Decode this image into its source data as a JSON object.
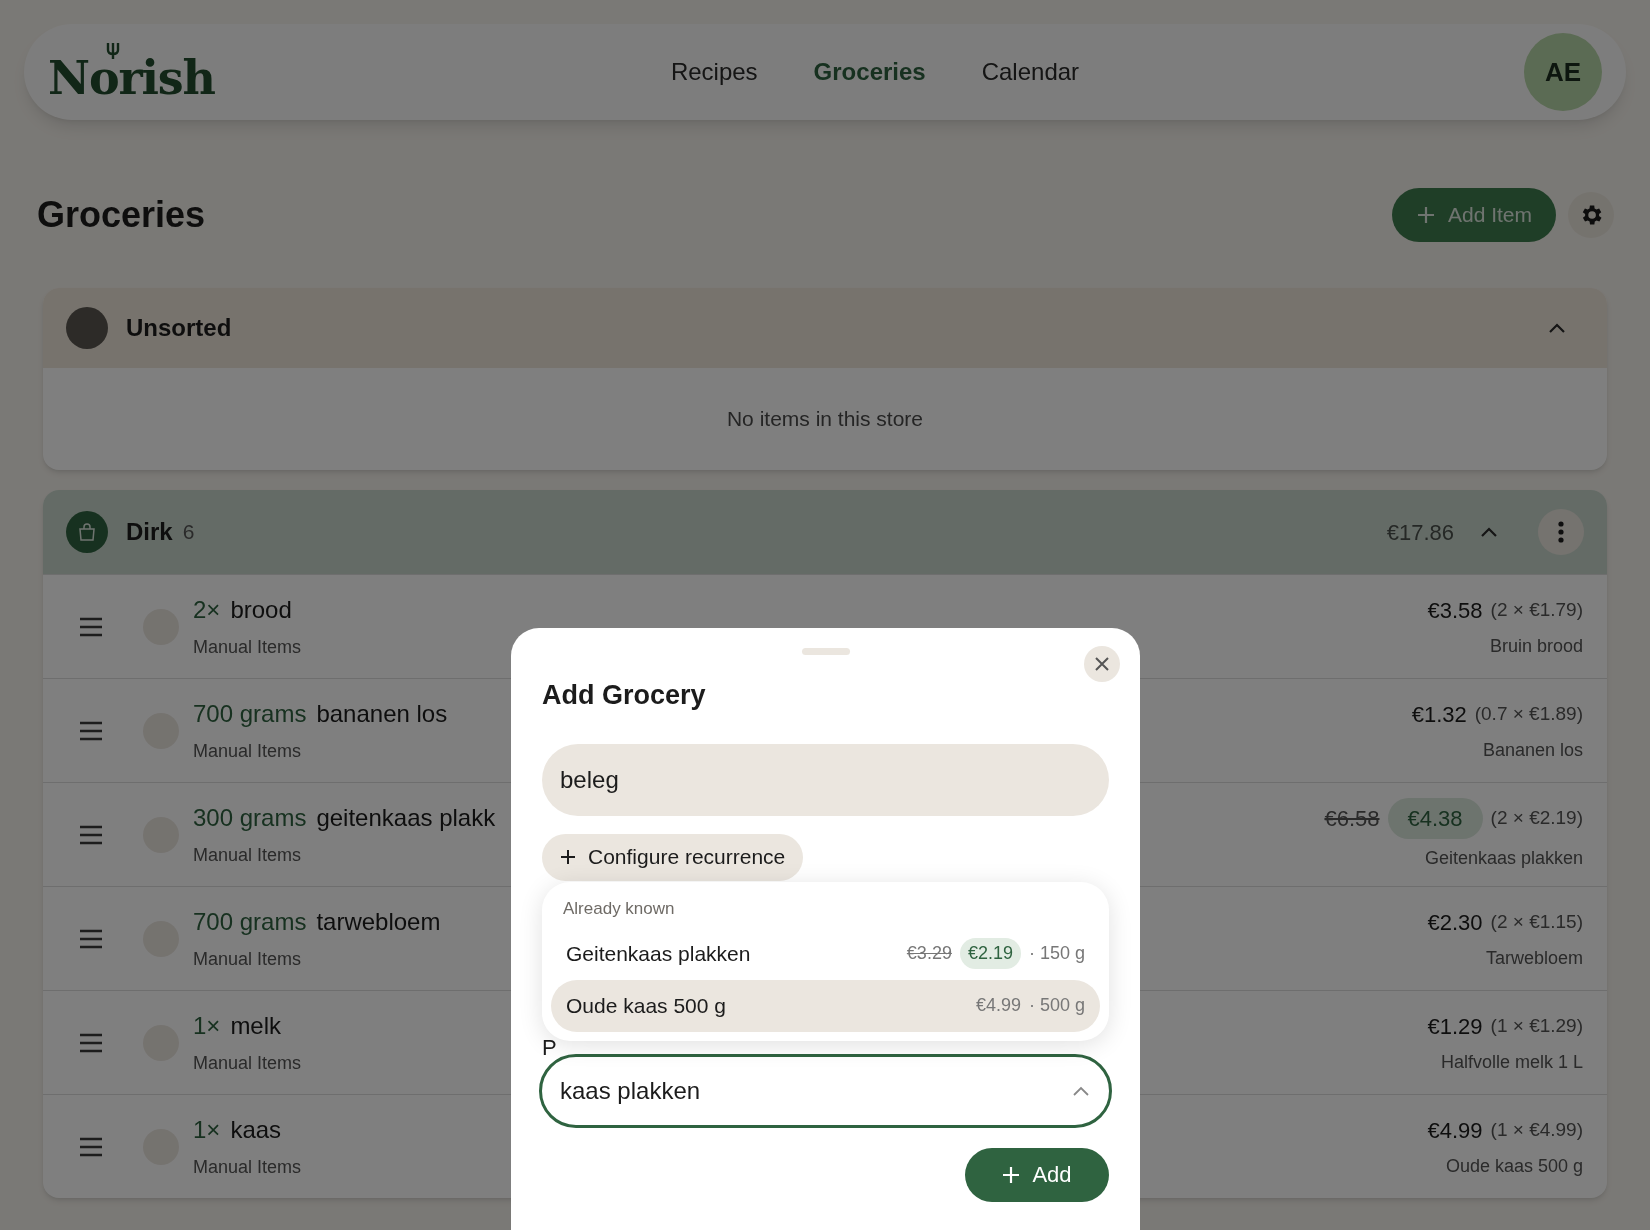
{
  "header": {
    "logo": "Norish",
    "nav": [
      {
        "label": "Recipes",
        "selected": false
      },
      {
        "label": "Groceries",
        "selected": true
      },
      {
        "label": "Calendar",
        "selected": false
      }
    ],
    "avatar": "AE"
  },
  "page": {
    "title": "Groceries",
    "add_button": "Add Item"
  },
  "stores": [
    {
      "kind": "unsorted",
      "name": "Unsorted",
      "expanded": true,
      "empty_text": "No items in this store"
    },
    {
      "kind": "store",
      "name": "Dirk",
      "count": "6",
      "total": "€17.86",
      "expanded": true,
      "items": [
        {
          "amount": "2×",
          "name": "brood",
          "source": "Manual Items",
          "checked": false,
          "price": "€3.58",
          "breakdown": "(2 × €1.79)",
          "product": "Bruin brood"
        },
        {
          "amount": "700 grams",
          "name": "bananen los",
          "source": "Manual Items",
          "checked": false,
          "price": "€1.32",
          "breakdown": "(0.7 × €1.89)",
          "product": "Bananen los"
        },
        {
          "amount": "300 grams",
          "name": "geitenkaas plakk",
          "source": "Manual Items",
          "checked": false,
          "old_price": "€6.58",
          "price": "€4.38",
          "breakdown": "(2 × €2.19)",
          "product": "Geitenkaas plakken"
        },
        {
          "amount": "700 grams",
          "name": "tarwebloem",
          "source": "Manual Items",
          "checked": false,
          "price": "€2.30",
          "breakdown": "(2 × €1.15)",
          "product": "Tarwebloem"
        },
        {
          "amount": "1×",
          "name": "melk",
          "source": "Manual Items",
          "checked": false,
          "price": "€1.29",
          "breakdown": "(1 × €1.29)",
          "product": "Halfvolle melk 1 L"
        },
        {
          "amount": "1×",
          "name": "kaas",
          "source": "Manual Items",
          "checked": false,
          "price": "€4.99",
          "breakdown": "(1 × €4.99)",
          "product": "Oude kaas 500 g"
        }
      ]
    }
  ],
  "dialog": {
    "title": "Add Grocery",
    "name_value": "beleg",
    "recurrence_button": "Configure recurrence",
    "suggestions": {
      "heading": "Already known",
      "options": [
        {
          "name": "Geitenkaas plakken",
          "old_price": "€3.29",
          "price": "€2.19",
          "unit": "· 150 g",
          "selected": false
        },
        {
          "name": "Oude kaas 500 g",
          "price": "€4.99",
          "unit": "· 500 g",
          "selected": true
        }
      ]
    },
    "product_label": "P",
    "product_value": "kaas plakken",
    "add_button": "Add"
  }
}
